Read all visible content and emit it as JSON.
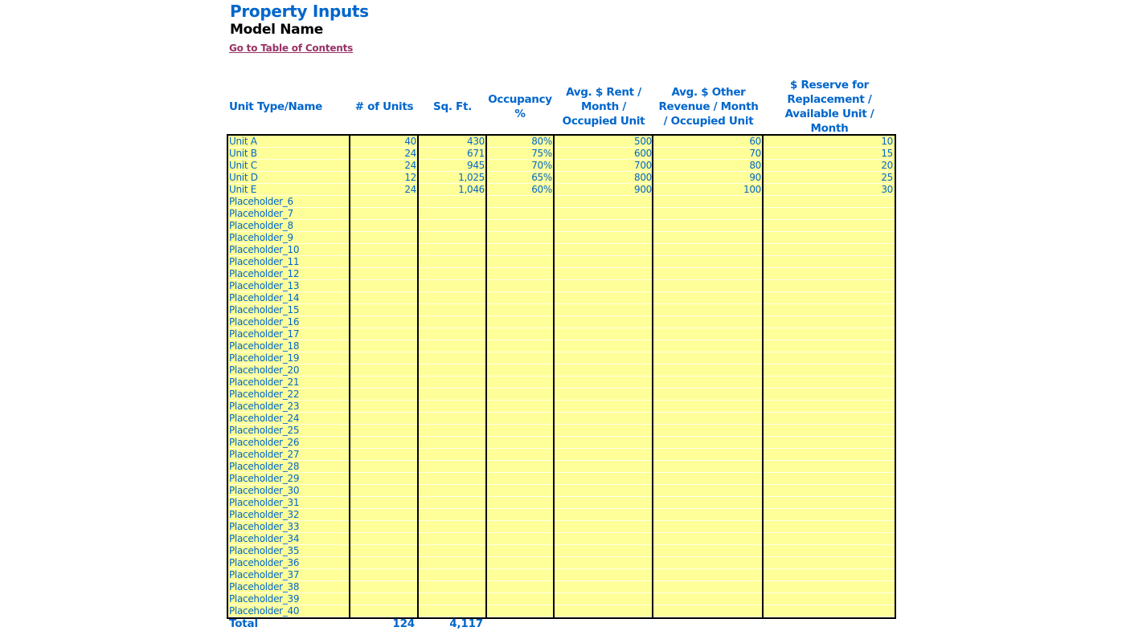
{
  "header": {
    "title": "Property Inputs",
    "model_name": "Model Name",
    "toc_link": "Go to Table of Contents"
  },
  "columns": [
    "Unit Type/Name",
    "# of Units",
    "Sq. Ft.",
    "Occupancy %",
    "Avg. $ Rent / Month / Occupied Unit",
    "Avg. $ Other Revenue / Month / Occupied Unit",
    "$ Reserve for Replacement / Available Unit / Month"
  ],
  "rows": [
    [
      "Unit A",
      "40",
      "430",
      "80%",
      "500",
      "60",
      "10"
    ],
    [
      "Unit B",
      "24",
      "671",
      "75%",
      "600",
      "70",
      "15"
    ],
    [
      "Unit C",
      "24",
      "945",
      "70%",
      "700",
      "80",
      "20"
    ],
    [
      "Unit D",
      "12",
      "1,025",
      "65%",
      "800",
      "90",
      "25"
    ],
    [
      "Unit E",
      "24",
      "1,046",
      "60%",
      "900",
      "100",
      "30"
    ],
    [
      "Placeholder_6",
      "",
      "",
      "",
      "",
      "",
      ""
    ],
    [
      "Placeholder_7",
      "",
      "",
      "",
      "",
      "",
      ""
    ],
    [
      "Placeholder_8",
      "",
      "",
      "",
      "",
      "",
      ""
    ],
    [
      "Placeholder_9",
      "",
      "",
      "",
      "",
      "",
      ""
    ],
    [
      "Placeholder_10",
      "",
      "",
      "",
      "",
      "",
      ""
    ],
    [
      "Placeholder_11",
      "",
      "",
      "",
      "",
      "",
      ""
    ],
    [
      "Placeholder_12",
      "",
      "",
      "",
      "",
      "",
      ""
    ],
    [
      "Placeholder_13",
      "",
      "",
      "",
      "",
      "",
      ""
    ],
    [
      "Placeholder_14",
      "",
      "",
      "",
      "",
      "",
      ""
    ],
    [
      "Placeholder_15",
      "",
      "",
      "",
      "",
      "",
      ""
    ],
    [
      "Placeholder_16",
      "",
      "",
      "",
      "",
      "",
      ""
    ],
    [
      "Placeholder_17",
      "",
      "",
      "",
      "",
      "",
      ""
    ],
    [
      "Placeholder_18",
      "",
      "",
      "",
      "",
      "",
      ""
    ],
    [
      "Placeholder_19",
      "",
      "",
      "",
      "",
      "",
      ""
    ],
    [
      "Placeholder_20",
      "",
      "",
      "",
      "",
      "",
      ""
    ],
    [
      "Placeholder_21",
      "",
      "",
      "",
      "",
      "",
      ""
    ],
    [
      "Placeholder_22",
      "",
      "",
      "",
      "",
      "",
      ""
    ],
    [
      "Placeholder_23",
      "",
      "",
      "",
      "",
      "",
      ""
    ],
    [
      "Placeholder_24",
      "",
      "",
      "",
      "",
      "",
      ""
    ],
    [
      "Placeholder_25",
      "",
      "",
      "",
      "",
      "",
      ""
    ],
    [
      "Placeholder_26",
      "",
      "",
      "",
      "",
      "",
      ""
    ],
    [
      "Placeholder_27",
      "",
      "",
      "",
      "",
      "",
      ""
    ],
    [
      "Placeholder_28",
      "",
      "",
      "",
      "",
      "",
      ""
    ],
    [
      "Placeholder_29",
      "",
      "",
      "",
      "",
      "",
      ""
    ],
    [
      "Placeholder_30",
      "",
      "",
      "",
      "",
      "",
      ""
    ],
    [
      "Placeholder_31",
      "",
      "",
      "",
      "",
      "",
      ""
    ],
    [
      "Placeholder_32",
      "",
      "",
      "",
      "",
      "",
      ""
    ],
    [
      "Placeholder_33",
      "",
      "",
      "",
      "",
      "",
      ""
    ],
    [
      "Placeholder_34",
      "",
      "",
      "",
      "",
      "",
      ""
    ],
    [
      "Placeholder_35",
      "",
      "",
      "",
      "",
      "",
      ""
    ],
    [
      "Placeholder_36",
      "",
      "",
      "",
      "",
      "",
      ""
    ],
    [
      "Placeholder_37",
      "",
      "",
      "",
      "",
      "",
      ""
    ],
    [
      "Placeholder_38",
      "",
      "",
      "",
      "",
      "",
      ""
    ],
    [
      "Placeholder_39",
      "",
      "",
      "",
      "",
      "",
      ""
    ],
    [
      "Placeholder_40",
      "",
      "",
      "",
      "",
      "",
      ""
    ]
  ],
  "totals": {
    "label": "Total",
    "units": "124",
    "sqft": "4,117"
  },
  "colors": {
    "heading_blue": "#0066CC",
    "input_yellow": "#FFFF99",
    "link": "#993366"
  }
}
